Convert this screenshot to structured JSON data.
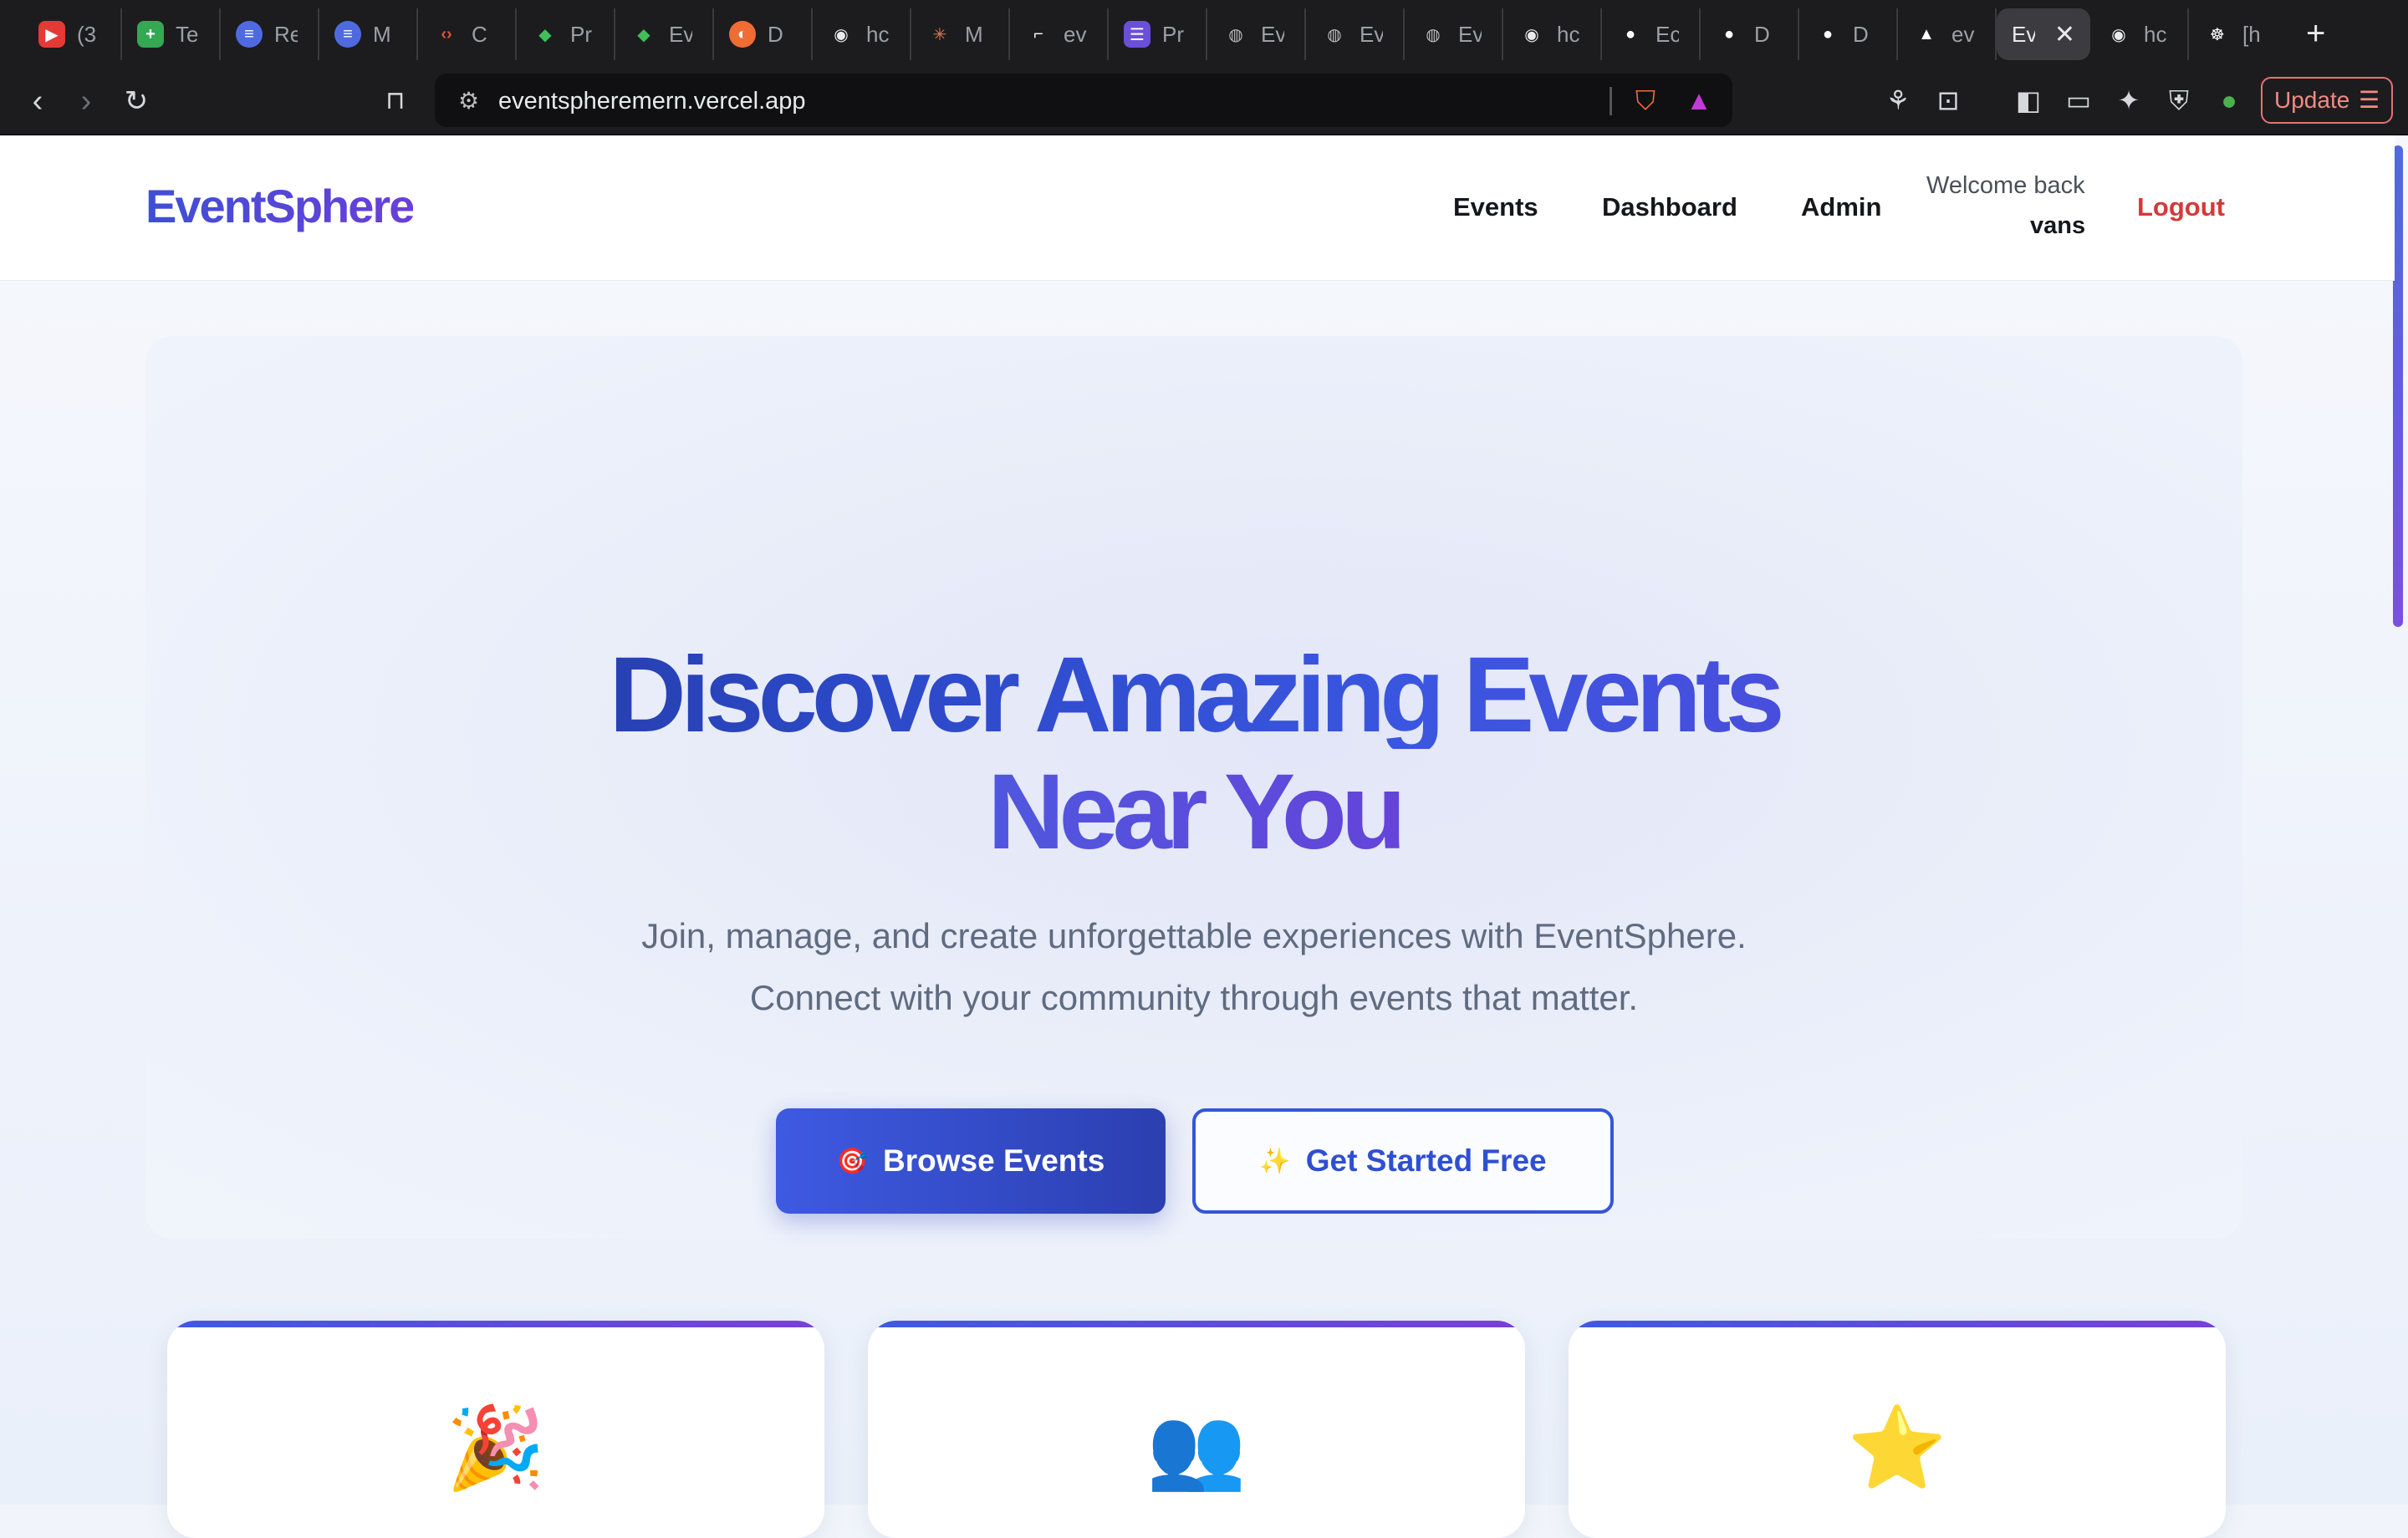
{
  "browser": {
    "tabs": [
      {
        "label": "(3",
        "favicon_color": "#e53935",
        "favicon": "▶"
      },
      {
        "label": "Te",
        "favicon_color": "#34a853",
        "favicon": "+"
      },
      {
        "label": "Re",
        "favicon_color": "#4f6ae0",
        "favicon": "≡"
      },
      {
        "label": "M",
        "favicon_color": "#4f6ae0",
        "favicon": "≡"
      },
      {
        "label": "C",
        "favicon_color": "#1c1c1f",
        "favicon": "‹›"
      },
      {
        "label": "Pr",
        "favicon_color": "#1c1c1f",
        "favicon": "◆"
      },
      {
        "label": "Ev",
        "favicon_color": "#1c1c1f",
        "favicon": "◆"
      },
      {
        "label": "D",
        "favicon_color": "#ef6c35",
        "favicon": "◐"
      },
      {
        "label": "hc",
        "favicon_color": "#5a5a5a",
        "favicon": "◉"
      },
      {
        "label": "M",
        "favicon_color": "#1c1c1f",
        "favicon": "✳"
      },
      {
        "label": "ev",
        "favicon_color": "#1c1c1f",
        "favicon": "⌐"
      },
      {
        "label": "Pr",
        "favicon_color": "#6a4fd8",
        "favicon": "☰"
      },
      {
        "label": "Ev",
        "favicon_color": "#5a5a5a",
        "favicon": "◍"
      },
      {
        "label": "Ev",
        "favicon_color": "#5a5a5a",
        "favicon": "◍"
      },
      {
        "label": "Ev",
        "favicon_color": "#5a5a5a",
        "favicon": "◍"
      },
      {
        "label": "hc",
        "favicon_color": "#5a5a5a",
        "favicon": "◉"
      },
      {
        "label": "Ec",
        "favicon_color": "#1c1c1f",
        "favicon": "●"
      },
      {
        "label": "D",
        "favicon_color": "#1c1c1f",
        "favicon": "●"
      },
      {
        "label": "D",
        "favicon_color": "#1c1c1f",
        "favicon": "●"
      },
      {
        "label": "ev",
        "favicon_color": "#1c1c1f",
        "favicon": "▲"
      }
    ],
    "active_tab": {
      "label": "Ev",
      "close": "✕"
    },
    "after_tabs": [
      {
        "label": "hc",
        "favicon_color": "#5a5a5a",
        "favicon": "◉"
      },
      {
        "label": "[h",
        "favicon_color": "#1c1c1f",
        "favicon": "☸"
      }
    ],
    "new_tab": "+",
    "url": "eventspheremern.vercel.app",
    "update_label": "Update"
  },
  "nav": {
    "logo": "EventSphere",
    "links": {
      "events": "Events",
      "dashboard": "Dashboard",
      "admin": "Admin"
    },
    "welcome": "Welcome back",
    "username": "vans",
    "logout": "Logout"
  },
  "hero": {
    "title_line1": "Discover Amazing Events",
    "title_line2": "Near You",
    "subtitle_line1": "Join, manage, and create unforgettable experiences with EventSphere.",
    "subtitle_line2": "Connect with your community through events that matter.",
    "primary_button": {
      "icon": "🎯",
      "label": "Browse Events"
    },
    "secondary_button": {
      "icon": "✨",
      "label": "Get Started Free"
    }
  },
  "features": [
    {
      "icon": "🎉"
    },
    {
      "icon": "👥"
    },
    {
      "icon": "⭐"
    }
  ],
  "colors": {
    "brand_start": "#3e4fd6",
    "brand_end": "#6a3fd8",
    "logout": "#d23a3a",
    "primary_button": "#2f4fd2"
  }
}
